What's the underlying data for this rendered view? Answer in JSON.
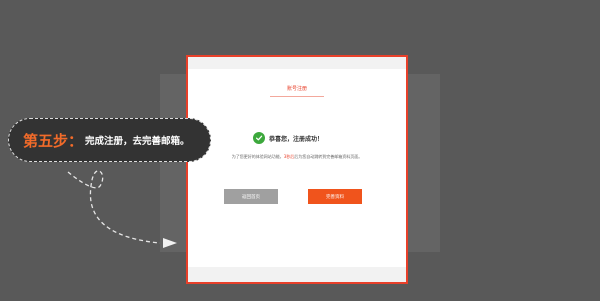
{
  "modal": {
    "tab_title": "账号注册",
    "success_message": "恭喜您，注册成功！",
    "description_before": "为了您更好的体验网站功能，",
    "description_highlight": "3秒后",
    "description_after": "后为您自动跳转到完善邮箱资料页面。",
    "home_button": "返回首页",
    "complete_button": "完善资料"
  },
  "callout": {
    "step_label": "第五步：",
    "step_text": "完成注册，去完善邮箱。"
  },
  "colors": {
    "accent": "#e8402a",
    "primary_button": "#f0541c",
    "secondary_button": "#a0a0a0",
    "success": "#3ca83c",
    "callout_step": "#f26b2a"
  },
  "icons": {
    "success": "check-circle-icon",
    "pointer": "dashed-arrow-icon"
  }
}
